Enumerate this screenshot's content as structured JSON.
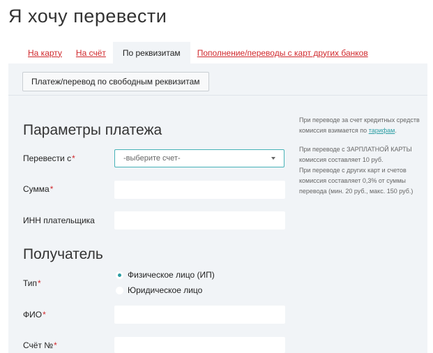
{
  "page": {
    "title": "Я хочу перевести"
  },
  "tabs": [
    {
      "label": "На карту",
      "active": false
    },
    {
      "label": "На счёт",
      "active": false
    },
    {
      "label": "По реквизитам",
      "active": true
    },
    {
      "label": "Пополнение/переводы с карт других банков",
      "active": false
    }
  ],
  "subbar": {
    "free_button_label": "Платеж/перевод по свободным реквизитам"
  },
  "params": {
    "title": "Параметры платежа",
    "from_label": "Перевести с",
    "from_select_value": "-выберите счет-",
    "amount_label": "Сумма",
    "inn_label": "ИНН плательщика"
  },
  "recipient": {
    "title": "Получатель",
    "type_label": "Тип",
    "type_options": [
      {
        "label": "Физическое лицо (ИП)",
        "checked": true
      },
      {
        "label": "Юридическое лицо",
        "checked": false
      }
    ],
    "name_label": "ФИО",
    "account_label": "Счёт №"
  },
  "required_mark": "*",
  "info": {
    "credit_text": "При переводе за счет кредитных средств комиссия взимается по",
    "tariff_link": "тарифам",
    "tariff_suffix": ".",
    "salary_text": "При переводе с ЗАРПЛАТНОЙ КАРТЫ комиссия составляет 10 руб.",
    "other_text": "При переводе с других карт и счетов комиссия составляет 0,3% от суммы перевода (мин. 20 руб., макс. 150 руб.)"
  },
  "colors": {
    "accent": "#d0282c",
    "teal": "#2b9da3",
    "panel_bg": "#f1f4f7"
  }
}
